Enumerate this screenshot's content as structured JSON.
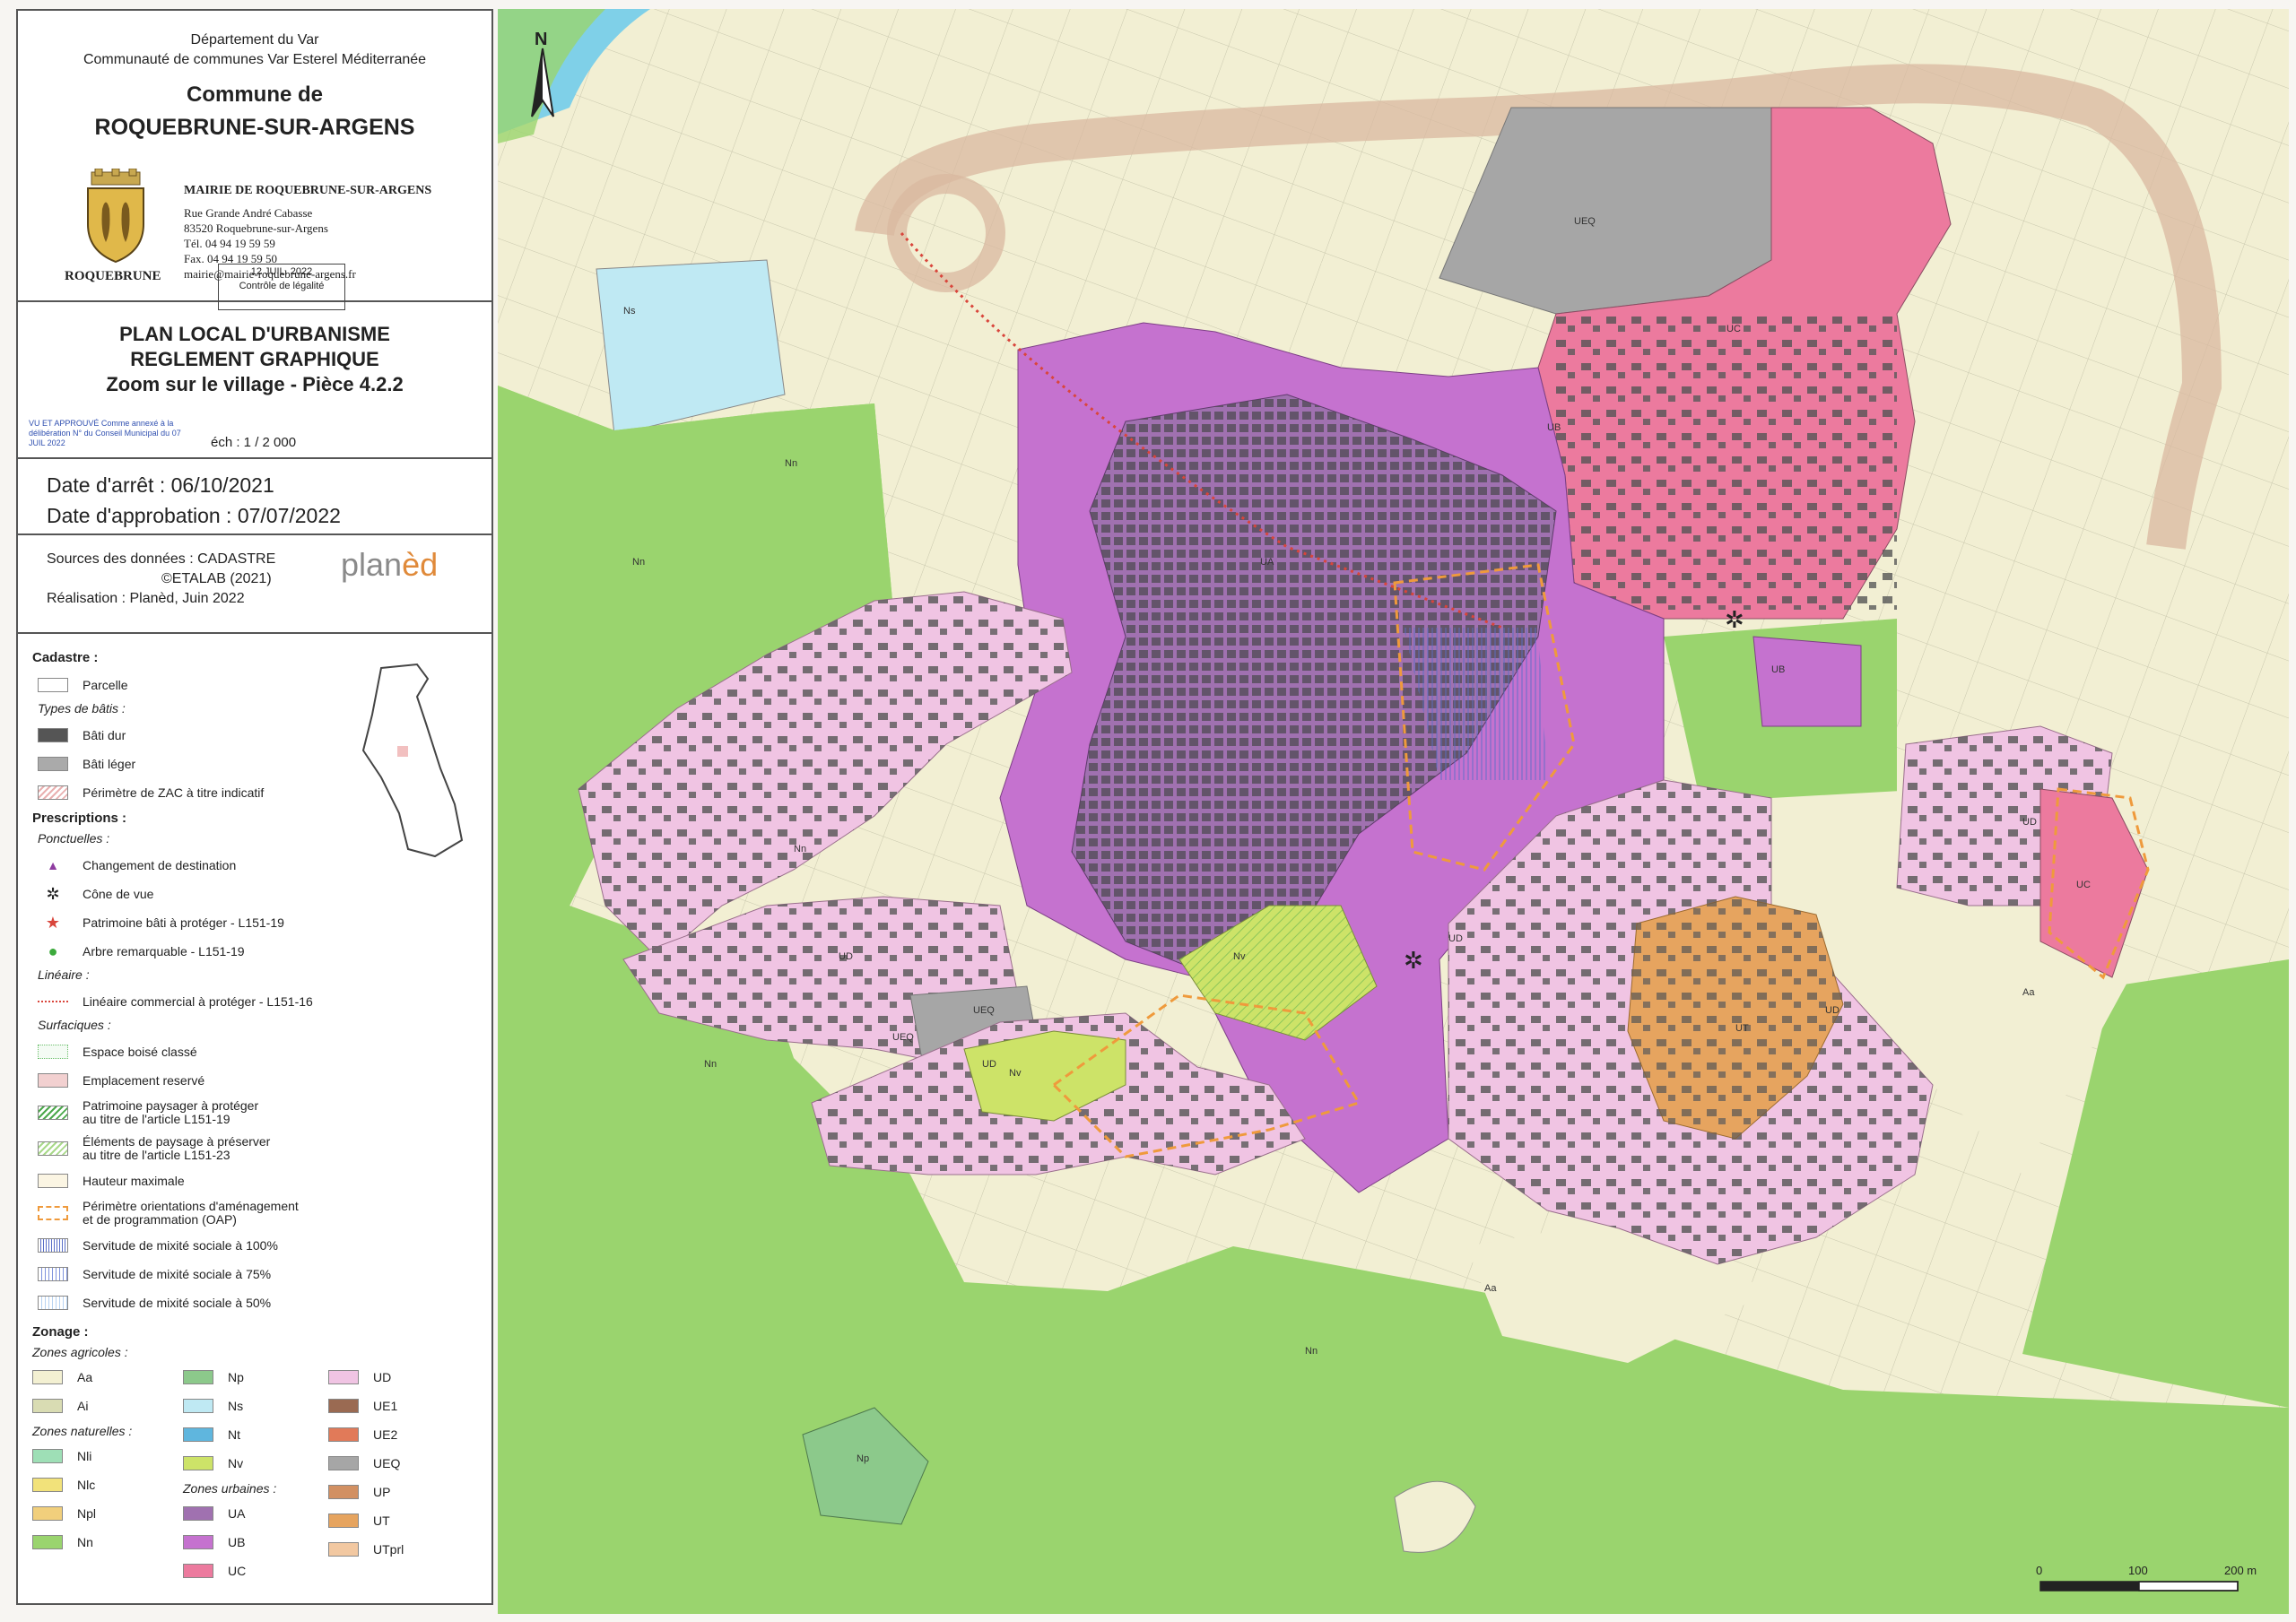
{
  "header": {
    "dept_line1": "Département du Var",
    "dept_line2": "Communauté de communes Var Esterel Méditerranée",
    "commune_line1": "Commune de",
    "commune_line2": "ROQUEBRUNE-SUR-ARGENS"
  },
  "mairie": {
    "title": "MAIRIE DE ROQUEBRUNE-SUR-ARGENS",
    "address1": "Rue Grande André Cabasse",
    "address2": "83520 Roquebrune-sur-Argens",
    "tel": "Tél. 04 94 19 59 59",
    "fax": "Fax. 04 94 19 59 50",
    "mail": "mairie@mairie-roquebrune-argens.fr",
    "logo_text": "ROQUEBRUNE",
    "stamp_date": "12 JUIL. 2022",
    "stamp_label": "Contrôle de légalité"
  },
  "document": {
    "title1": "PLAN LOCAL D'URBANISME",
    "title2": "REGLEMENT GRAPHIQUE",
    "title3": "Zoom sur le village - Pièce 4.2.2",
    "scale": "éch : 1 / 2 000",
    "approval_stamp": "VU ET APPROUVÉ Comme annexé à la délibération N° du Conseil Municipal du 07 JUIL 2022"
  },
  "dates": {
    "arret": "Date d'arrêt : 06/10/2021",
    "approbation": "Date d'approbation : 07/07/2022"
  },
  "sources": {
    "line1": "Sources des données : CADASTRE",
    "line2": "©ETALAB (2021)",
    "line3": "Réalisation : Planèd, Juin 2022",
    "logo_a": "plan",
    "logo_b": "èd"
  },
  "legend": {
    "cadastre_title": "Cadastre :",
    "parcelle": "Parcelle",
    "types_bati": "Types de bâtis :",
    "bati_dur": "Bâti dur",
    "bati_leger": "Bâti léger",
    "zac": "Périmètre de ZAC à titre indicatif",
    "prescriptions_title": "Prescriptions :",
    "ponctuelles": "Ponctuelles :",
    "changement": "Changement de destination",
    "cone": "Cône de vue",
    "patrimoine_bati": "Patrimoine bâti à protéger - L151-19",
    "arbre": "Arbre remarquable - L151-19",
    "lineaire": "Linéaire :",
    "lineaire_commercial": "Linéaire commercial à protéger - L151-16",
    "surfaciques": "Surfaciques :",
    "ebc": "Espace boisé classé",
    "er": "Emplacement reservé",
    "pp1": "Patrimoine paysager à protéger",
    "pp2": "au titre de l'article L151-19",
    "ep1": "Éléments de paysage à préserver",
    "ep2": "au titre de l'article L151-23",
    "hauteur": "Hauteur maximale",
    "oap1": "Périmètre orientations d'aménagement",
    "oap2": "et de programmation (OAP)",
    "smx100": "Servitude de mixité sociale à 100%",
    "smx75": "Servitude de mixité sociale à 75%",
    "smx50": "Servitude de mixité sociale à 50%",
    "zonage_title": "Zonage :",
    "zones_agricoles": "Zones agricoles :",
    "zones_naturelles": "Zones naturelles :",
    "zones_urbaines": "Zones urbaines :"
  },
  "zones": {
    "agricoles": [
      {
        "code": "Aa",
        "color": "#f3f0d2"
      },
      {
        "code": "Ai",
        "color": "#d9dcb3"
      }
    ],
    "naturelles": [
      {
        "code": "Nli",
        "color": "#9edfb6"
      },
      {
        "code": "Nlc",
        "color": "#f2e27a"
      },
      {
        "code": "Npl",
        "color": "#f1cf7c"
      },
      {
        "code": "Nn",
        "color": "#9ad46e"
      },
      {
        "code": "Np",
        "color": "#8cc98b"
      },
      {
        "code": "Ns",
        "color": "#bfe9f3"
      },
      {
        "code": "Nt",
        "color": "#5fb6de"
      },
      {
        "code": "Nv",
        "color": "#cde368"
      }
    ],
    "urbaines": [
      {
        "code": "UA",
        "color": "#a071b0"
      },
      {
        "code": "UB",
        "color": "#c572cf"
      },
      {
        "code": "UC",
        "color": "#ec7a9e"
      },
      {
        "code": "UD",
        "color": "#f0c4e3"
      },
      {
        "code": "UE1",
        "color": "#9a6a52"
      },
      {
        "code": "UE2",
        "color": "#e17a59"
      },
      {
        "code": "UEQ",
        "color": "#a6a6a6"
      },
      {
        "code": "UP",
        "color": "#d29062"
      },
      {
        "code": "UT",
        "color": "#e6a45f"
      },
      {
        "code": "UTprl",
        "color": "#f2c8a1"
      }
    ]
  },
  "map": {
    "north": "N",
    "scale_0": "0",
    "scale_100": "100",
    "scale_200": "200 m",
    "labels": [
      "Ns",
      "Nn",
      "Nn",
      "Nn",
      "Nn",
      "Nn",
      "UD",
      "UD",
      "UD",
      "UD",
      "UD",
      "UEQ",
      "UEQ",
      "UEQ",
      "UB",
      "UB",
      "UA",
      "UC",
      "UC",
      "UT",
      "Aa",
      "Aa",
      "Nv",
      "Nv",
      "Np"
    ]
  }
}
